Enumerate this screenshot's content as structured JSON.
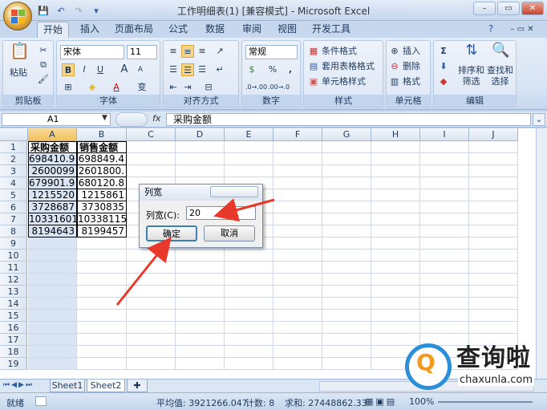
{
  "window": {
    "title": "工作明细表(1) [兼容模式] - Microsoft Excel",
    "min": "–",
    "restore": "▭",
    "close": "✕"
  },
  "tabs": [
    {
      "label": "开始"
    },
    {
      "label": "插入"
    },
    {
      "label": "页面布局"
    },
    {
      "label": "公式"
    },
    {
      "label": "数据"
    },
    {
      "label": "审阅"
    },
    {
      "label": "视图"
    },
    {
      "label": "开发工具"
    }
  ],
  "ribbon": {
    "clipboard": {
      "label": "剪贴板",
      "paste": "粘贴"
    },
    "font": {
      "label": "字体",
      "name": "宋体",
      "size": "11",
      "bold": "B",
      "italic": "I",
      "underline": "U",
      "grow": "A",
      "shrink": "A",
      "color": "A",
      "phonetic": "变"
    },
    "alignment": {
      "label": "对齐方式"
    },
    "number": {
      "label": "数字",
      "format": "常规",
      "percent": "%",
      "comma": ","
    },
    "styles": {
      "label": "样式",
      "conditional": "条件格式",
      "table": "套用表格格式",
      "cellstyle": "单元格样式"
    },
    "cells": {
      "label": "单元格",
      "insert": "插入",
      "delete": "删除",
      "format": "格式"
    },
    "editing": {
      "label": "编辑",
      "sort": "排序和\n筛选",
      "find": "查找和\n选择",
      "sigma": "Σ"
    }
  },
  "formula_bar": {
    "name_box": "A1",
    "fx": "fx",
    "content": "采购金额"
  },
  "columns": [
    "A",
    "B",
    "C",
    "D",
    "E",
    "F",
    "G",
    "H",
    "I",
    "J"
  ],
  "rows": [
    "1",
    "2",
    "3",
    "4",
    "5",
    "6",
    "7",
    "8",
    "9",
    "10",
    "11",
    "12",
    "13",
    "14",
    "15",
    "16",
    "17",
    "18",
    "19"
  ],
  "table": {
    "headers": [
      "采购金额",
      "销售金额"
    ],
    "rows": [
      [
        "698410.9",
        "698849.4"
      ],
      [
        "2600099",
        "2601800."
      ],
      [
        "679901.9",
        "680120.8"
      ],
      [
        "1215520",
        "1215861"
      ],
      [
        "3728687",
        "3730835"
      ],
      [
        "10331601",
        "10338115"
      ],
      [
        "8194643",
        "8199457"
      ]
    ]
  },
  "dialog": {
    "title": "列宽",
    "label": "列宽(C):",
    "value": "20",
    "ok": "确定",
    "cancel": "取消"
  },
  "sheet_tabs": [
    "Sheet1",
    "Sheet2"
  ],
  "status": {
    "ready": "就绪",
    "average": "平均值: 3921266.047",
    "count": "计数: 8",
    "sum": "求和: 27448862.33",
    "zoom": "100%"
  },
  "watermark": {
    "brand": "查询啦",
    "url": "chaxunla.com",
    "q": "Q"
  }
}
